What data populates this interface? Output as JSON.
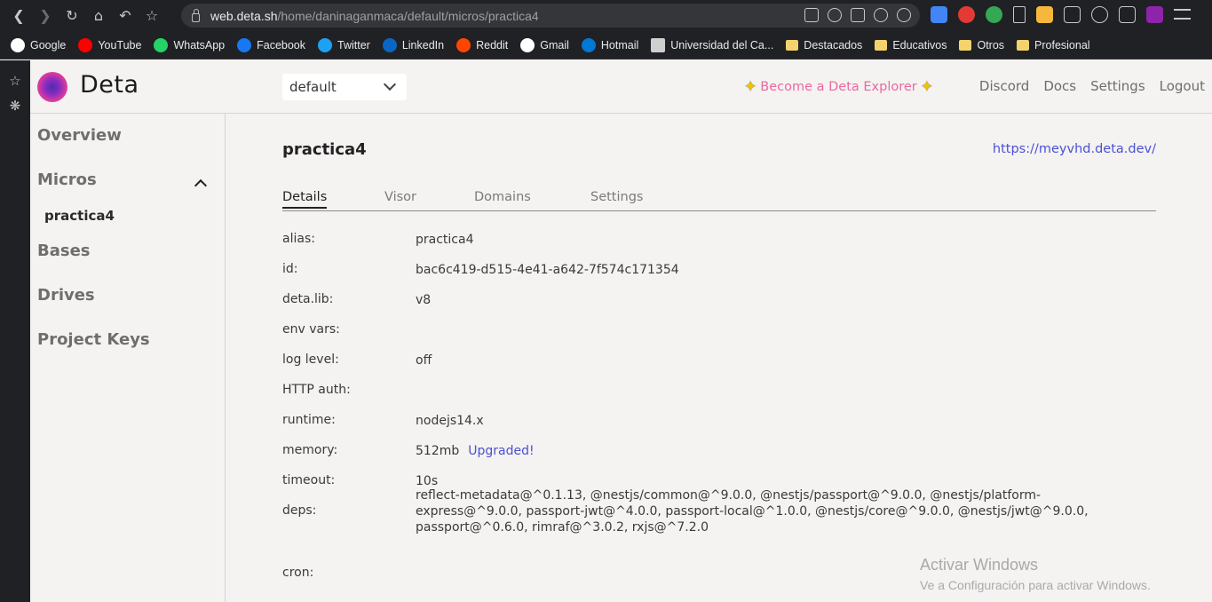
{
  "browser": {
    "url_host": "web.deta.sh",
    "url_path": "/home/daninaganmaca/default/micros/practica4",
    "bookmarks": [
      {
        "label": "Google",
        "icon": "google-icon",
        "color": "#ffffff"
      },
      {
        "label": "YouTube",
        "icon": "youtube-icon",
        "color": "#ff0000"
      },
      {
        "label": "WhatsApp",
        "icon": "whatsapp-icon",
        "color": "#25d366"
      },
      {
        "label": "Facebook",
        "icon": "facebook-icon",
        "color": "#1877f2"
      },
      {
        "label": "Twitter",
        "icon": "twitter-icon",
        "color": "#1da1f2"
      },
      {
        "label": "LinkedIn",
        "icon": "linkedin-icon",
        "color": "#0a66c2"
      },
      {
        "label": "Reddit",
        "icon": "reddit-icon",
        "color": "#ff4500"
      },
      {
        "label": "Gmail",
        "icon": "gmail-icon",
        "color": "#ffffff"
      },
      {
        "label": "Hotmail",
        "icon": "outlook-icon",
        "color": "#0078d4"
      },
      {
        "label": "Universidad del Ca...",
        "icon": "university-icon",
        "color": "#cfcfcf"
      },
      {
        "label": "Destacados",
        "icon": "folder-icon",
        "color": "#f4d36e"
      },
      {
        "label": "Educativos",
        "icon": "folder-icon",
        "color": "#f4d36e"
      },
      {
        "label": "Otros",
        "icon": "folder-icon",
        "color": "#f4d36e"
      },
      {
        "label": "Profesional",
        "icon": "folder-icon",
        "color": "#f4d36e"
      }
    ]
  },
  "header": {
    "brand": "Deta",
    "project": "default",
    "explorer_label": "Become a Deta Explorer",
    "nav": [
      "Discord",
      "Docs",
      "Settings",
      "Logout"
    ]
  },
  "sidebar": {
    "overview": "Overview",
    "micros": "Micros",
    "micro_item": "practica4",
    "bases": "Bases",
    "drives": "Drives",
    "project_keys": "Project Keys"
  },
  "main": {
    "title": "practica4",
    "endpoint": "https://meyvhd.deta.dev/",
    "tabs": [
      "Details",
      "Visor",
      "Domains",
      "Settings"
    ],
    "details": [
      {
        "key": "alias:",
        "value": "practica4"
      },
      {
        "key": "id:",
        "value": "bac6c419-d515-4e41-a642-7f574c171354"
      },
      {
        "key": "deta.lib:",
        "value": "v8"
      },
      {
        "key": "env vars:",
        "value": ""
      },
      {
        "key": "log level:",
        "value": "off"
      },
      {
        "key": "HTTP auth:",
        "value": ""
      },
      {
        "key": "runtime:",
        "value": "nodejs14.x"
      },
      {
        "key": "memory:",
        "value": "512mb",
        "extra": "Upgraded!"
      },
      {
        "key": "timeout:",
        "value": "10s"
      },
      {
        "key": "deps:",
        "value": "reflect-metadata@^0.1.13, @nestjs/common@^9.0.0, @nestjs/passport@^9.0.0, @nestjs/platform-express@^9.0.0, passport-jwt@^4.0.0, passport-local@^1.0.0, @nestjs/core@^9.0.0, @nestjs/jwt@^9.0.0, passport@^0.6.0, rimraf@^3.0.2, rxjs@^7.2.0"
      },
      {
        "key": "cron:",
        "value": ""
      }
    ]
  },
  "watermark": {
    "line1": "Activar Windows",
    "line2": "Ve a Configuración para activar Windows."
  },
  "colors": {
    "accent_link": "#4a52d1",
    "explorer_pink": "#e8699f",
    "background": "#f5f2f2"
  }
}
